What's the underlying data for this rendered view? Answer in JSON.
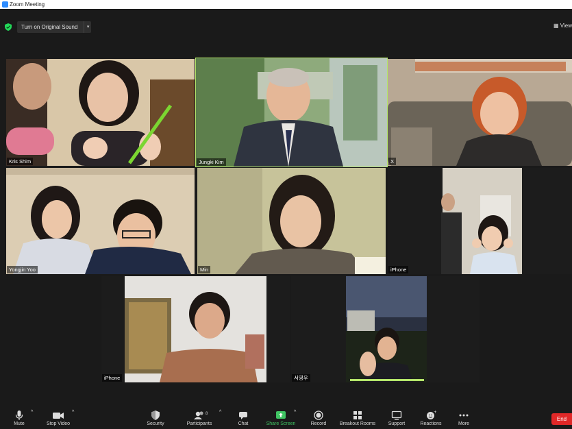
{
  "window": {
    "title": "Zoom Meeting"
  },
  "top_bar": {
    "sound_button": "Turn on Original Sound",
    "view_label": "View"
  },
  "participants": [
    {
      "name": "Kris  Shim",
      "active": false
    },
    {
      "name": "Jungki Kim",
      "active": true
    },
    {
      "name": "X",
      "active": false
    },
    {
      "name": "Yongjin Yoo",
      "active": false
    },
    {
      "name": "Min",
      "active": false
    },
    {
      "name": "iPhone",
      "active": false
    },
    {
      "name": "iPhone",
      "active": false
    },
    {
      "name": "서영우",
      "active": false
    }
  ],
  "toolbar": {
    "mute": "Mute",
    "stop_video": "Stop Video",
    "security": "Security",
    "participants": "Participants",
    "participants_count": "8",
    "chat": "Chat",
    "share_screen": "Share Screen",
    "record": "Record",
    "breakout_rooms": "Breakout Rooms",
    "support": "Support",
    "reactions": "Reactions",
    "more": "More",
    "end": "End"
  },
  "colors": {
    "active_border": "#b5e66b",
    "share_green": "#40c463",
    "end_red": "#e02828",
    "background": "#1a1a1a"
  }
}
